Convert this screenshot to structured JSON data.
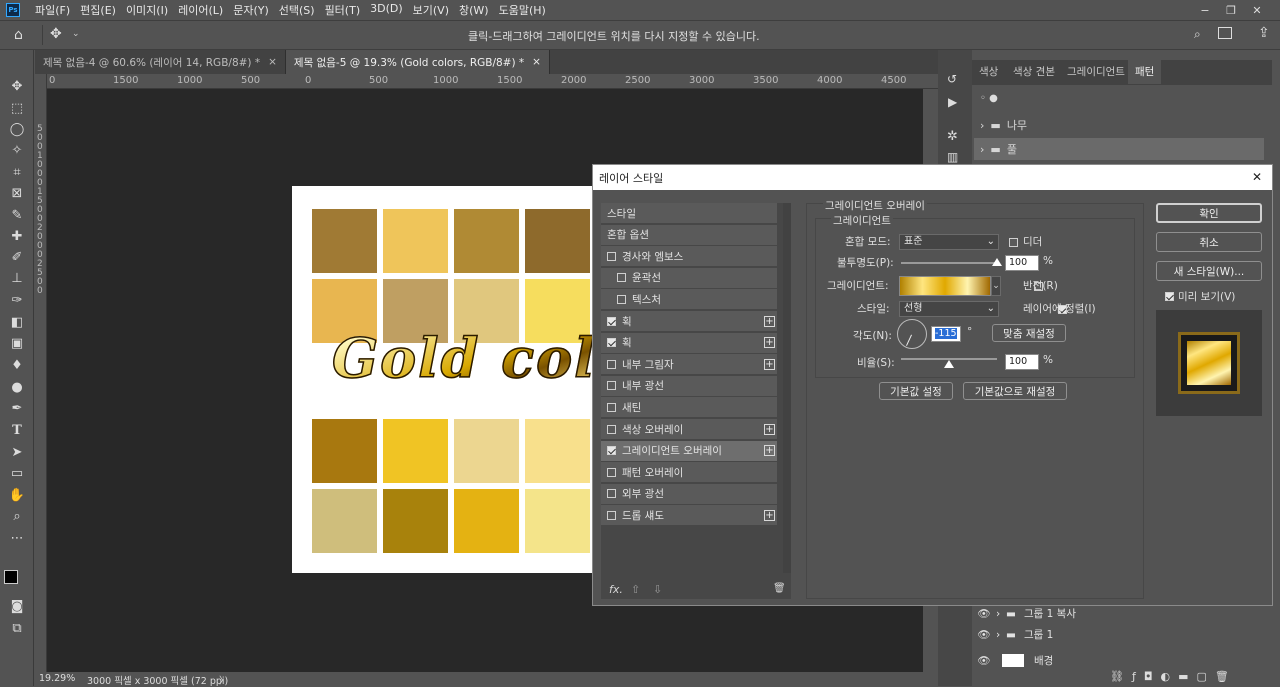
{
  "app": {
    "logo": "Ps"
  },
  "menu": [
    "파일(F)",
    "편집(E)",
    "이미지(I)",
    "레이어(L)",
    "문자(Y)",
    "선택(S)",
    "필터(T)",
    "3D(D)",
    "보기(V)",
    "창(W)",
    "도움말(H)"
  ],
  "window_controls": [
    "−",
    "❐",
    "✕"
  ],
  "options_bar": {
    "hint": "클릭-드래그하여 그레이디언트 위치를 다시 지정할 수 있습니다."
  },
  "tabs": [
    {
      "label": "제목 없음-4 @ 60.6% (레이어 14, RGB/8#) *",
      "close": "×"
    },
    {
      "label": "제목 없음-5 @ 19.3% (Gold colors, RGB/8#) *",
      "close": "×"
    }
  ],
  "ruler": {
    "h": [
      "0",
      "1500",
      "1000",
      "500",
      "0",
      "500",
      "1000",
      "1500",
      "2000",
      "2500",
      "3000",
      "3500",
      "4000",
      "4500"
    ],
    "v": [
      "5",
      "0",
      "0",
      "1",
      "0",
      "0",
      "0",
      "1",
      "5",
      "0",
      "0",
      "2",
      "0",
      "0",
      "0",
      "2",
      "5",
      "0",
      "0"
    ]
  },
  "document": {
    "title_text": "Gold colors",
    "swatches": [
      [
        "#a07a34",
        "#efc55a",
        "#b08a34",
        "#8e6a2c"
      ],
      [
        "#e8b650",
        "#bf9f62",
        "#e0c77e",
        "#f6dd5e"
      ],
      [
        "#a8780f",
        "#f0c424",
        "#ecd690",
        "#f8e08c"
      ],
      [
        "#cfbe7c",
        "#a8820c",
        "#e4b212",
        "#f4e48a"
      ]
    ]
  },
  "status": {
    "zoom": "19.29%",
    "size": "3000 픽셀 x 3000 픽셀 (72 ppi)",
    "arrow": "〉"
  },
  "right_panel": {
    "tabs": [
      "색상",
      "색상 견본",
      "그레이디언트",
      "패턴"
    ],
    "patterns": [
      {
        "label": "나무"
      },
      {
        "label": "풀"
      }
    ],
    "layers": [
      {
        "label": "그룹 1 복사"
      },
      {
        "label": "그룹 1"
      },
      {
        "label": "배경"
      }
    ]
  },
  "dialog": {
    "title": "레이어 스타일",
    "close": "✕",
    "styles": [
      {
        "label": "스타일",
        "checkbox": false,
        "plus": false,
        "header": true
      },
      {
        "label": "혼합 옵션",
        "checkbox": false,
        "plus": false,
        "header": true
      },
      {
        "label": "경사와 엠보스",
        "checkbox": true,
        "checked": false,
        "plus": false
      },
      {
        "label": "윤곽선",
        "checkbox": true,
        "checked": false,
        "plus": false,
        "indent": true
      },
      {
        "label": "텍스처",
        "checkbox": true,
        "checked": false,
        "plus": false,
        "indent": true
      },
      {
        "label": "획",
        "checkbox": true,
        "checked": true,
        "plus": true
      },
      {
        "label": "획",
        "checkbox": true,
        "checked": true,
        "plus": true
      },
      {
        "label": "내부 그림자",
        "checkbox": true,
        "checked": false,
        "plus": true
      },
      {
        "label": "내부 광선",
        "checkbox": true,
        "checked": false,
        "plus": false
      },
      {
        "label": "새틴",
        "checkbox": true,
        "checked": false,
        "plus": false
      },
      {
        "label": "색상 오버레이",
        "checkbox": true,
        "checked": false,
        "plus": true
      },
      {
        "label": "그레이디언트 오버레이",
        "checkbox": true,
        "checked": true,
        "plus": true,
        "selected": true
      },
      {
        "label": "패턴 오버레이",
        "checkbox": true,
        "checked": false,
        "plus": false
      },
      {
        "label": "외부 광선",
        "checkbox": true,
        "checked": false,
        "plus": false
      },
      {
        "label": "드롭 섀도",
        "checkbox": true,
        "checked": false,
        "plus": true
      }
    ],
    "footer_icons": {
      "fx": "fx.",
      "up": "⇧",
      "down": "⇩",
      "trash": "🗑"
    },
    "section_title": "그레이디언트 오버레이",
    "sub_title": "그레이디언트",
    "blend_mode": {
      "label": "혼합 모드:",
      "value": "표준"
    },
    "dither": {
      "label": "디더",
      "checked": false
    },
    "opacity": {
      "label": "불투명도(P):",
      "value": "100",
      "unit": "%",
      "level": 1.0
    },
    "gradient": {
      "label": "그레이디언트:",
      "colors": [
        "#b08000",
        "#ffe680",
        "#e0a800",
        "#fff4b0",
        "#a06800"
      ]
    },
    "reverse": {
      "label": "반전(R)",
      "checked": false
    },
    "style": {
      "label": "스타일:",
      "value": "선형"
    },
    "align": {
      "label": "레이어에 정렬(I)",
      "checked": true
    },
    "angle": {
      "label": "각도(N):",
      "value": "-115",
      "unit": "°"
    },
    "reset_align": "맞춤 재설정",
    "scale": {
      "label": "비율(S):",
      "value": "100",
      "unit": "%",
      "level": 0.5
    },
    "make_default": "기본값 설정",
    "reset_default": "기본값으로 재설정",
    "buttons": {
      "ok": "확인",
      "cancel": "취소",
      "new_style": "새 스타일(W)..."
    },
    "preview": {
      "label": "미리 보기(V)",
      "checked": true
    }
  }
}
